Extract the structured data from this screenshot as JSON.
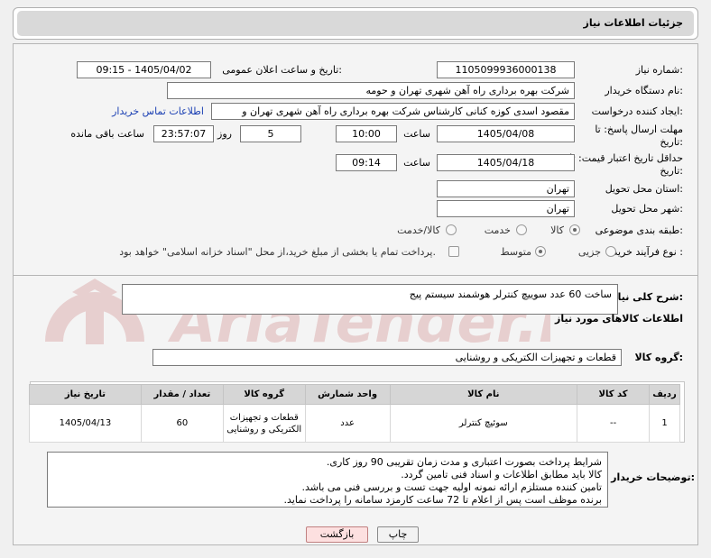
{
  "header": {
    "title": "جزئیات اطلاعات نیاز"
  },
  "fields": {
    "need_number": {
      "label": "شماره نیاز:",
      "value": "1105099936000138"
    },
    "announce_datetime": {
      "label": "تاریخ و ساعت اعلان عمومی:",
      "value": "1405/04/02 - 09:15"
    },
    "buyer_org": {
      "label": "نام دستگاه خریدار:",
      "value": "شرکت بهره برداری راه آهن شهری تهران و حومه"
    },
    "requester": {
      "label": "ایجاد کننده درخواست:",
      "value": "مقصود اسدی کوزه کنانی کارشناس شرکت بهره برداری راه آهن شهری تهران و",
      "contact_link": "اطلاعات تماس خریدار"
    },
    "response_deadline": {
      "label": "مهلت ارسال پاسخ: تا تاریخ:",
      "date": "1405/04/08",
      "time_label": "ساعت",
      "time": "10:00",
      "days": "5",
      "days_label": "روز و",
      "remaining": "23:57:07",
      "remaining_label": "ساعت باقی مانده"
    },
    "price_validity": {
      "label": "حداقل تاریخ اعتبار قیمت: تا تاریخ:",
      "date": "1405/04/18",
      "time_label": "ساعت",
      "time": "09:14"
    },
    "delivery_province": {
      "label": "استان محل تحویل:",
      "value": "تهران"
    },
    "delivery_city": {
      "label": "شهر محل تحویل:",
      "value": "تهران"
    },
    "category": {
      "label": "طبقه بندی موضوعی:",
      "options": [
        "کالا",
        "خدمت",
        "کالا/خدمت"
      ],
      "selected": "کالا"
    },
    "process_type": {
      "label": "نوع فرآیند خرید :",
      "options": [
        "جزیی",
        "متوسط"
      ],
      "selected": "متوسط",
      "treasury_note": "پرداخت تمام یا بخشی از مبلغ خرید،از محل \"اسناد خزانه اسلامی\" خواهد بود."
    }
  },
  "general_desc": {
    "label": "شرح کلی نیاز:",
    "value": "ساخت 60 عدد سوییچ کنترلر هوشمند سیستم پیج"
  },
  "goods_section": {
    "title": "اطلاعات کالاهای مورد نیاز",
    "group_label": "گروه کالا:",
    "group_value": "قطعات و تجهیزات الکتریکی و روشنایی"
  },
  "table": {
    "headers": [
      "ردیف",
      "کد کالا",
      "نام کالا",
      "واحد شمارش",
      "گروه کالا",
      "تعداد / مقدار",
      "تاریخ نیاز"
    ],
    "rows": [
      {
        "row": "1",
        "code": "--",
        "name": "سوئیچ کنترلر",
        "unit": "عدد",
        "group": "قطعات و تجهیزات الکتریکی و روشنایی",
        "qty": "60",
        "date": "1405/04/13"
      }
    ]
  },
  "buyer_notes": {
    "label": "توضیحات خریدار:",
    "lines": [
      "شرایط پرداخت بصورت اعتباری و مدت زمان تقریبی 90 روز کاری.",
      "کالا باید مطابق اطلاعات و اسناد فنی تامین گردد.",
      "تامین کننده مستلزم ارائه نمونه اولیه جهت تست و بررسی فنی می باشد.",
      "برنده موظف است پس از اعلام  تا 72 ساعت کارمزد سامانه را پرداخت نماید."
    ]
  },
  "buttons": {
    "print": "چاپ",
    "back": "بازگشت"
  },
  "watermark": {
    "text": "AriaTender.neT"
  }
}
